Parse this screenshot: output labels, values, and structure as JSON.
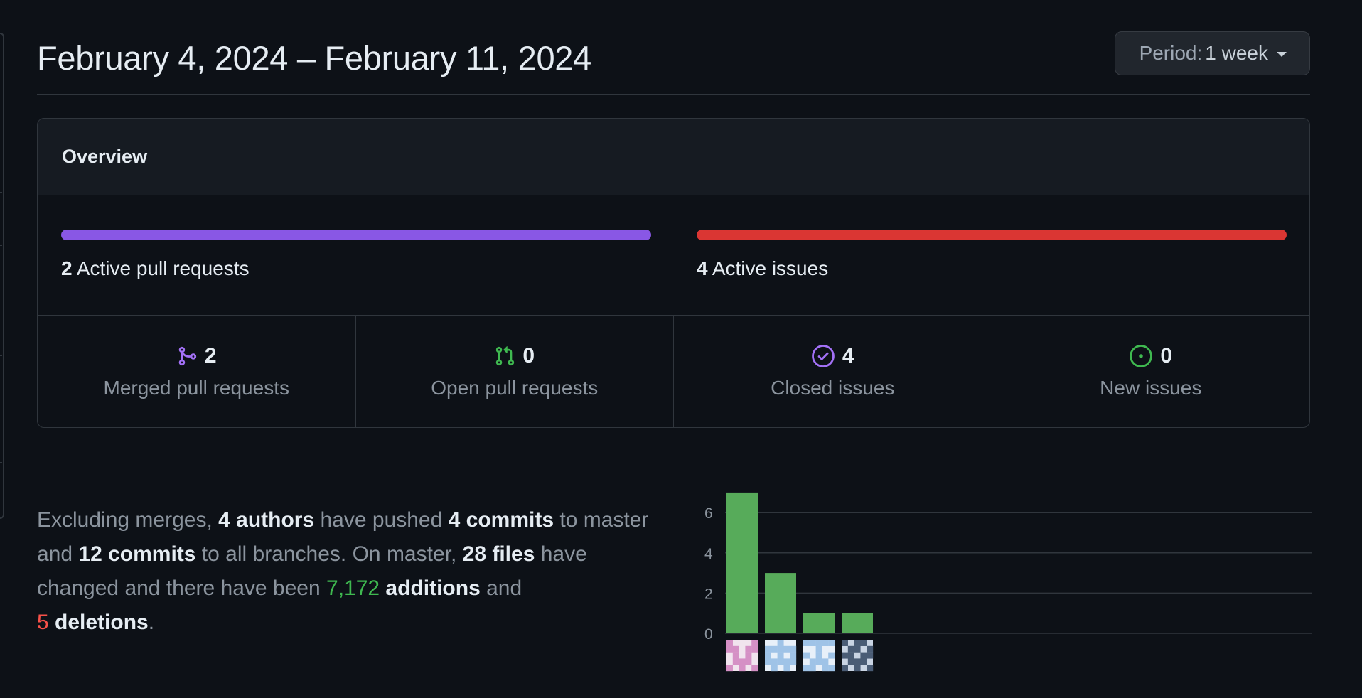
{
  "header": {
    "title": "February 4, 2024 – February 11, 2024",
    "period_prefix": "Period:",
    "period_value": "1 week"
  },
  "overview": {
    "heading": "Overview",
    "active_prs_count": "2",
    "active_prs_label": "Active pull requests",
    "active_issues_count": "4",
    "active_issues_label": "Active issues",
    "pr_bar_color": "#8957e5",
    "issue_bar_color": "#da3633",
    "stats": [
      {
        "icon": "git-merge-icon",
        "count": "2",
        "label": "Merged pull requests",
        "color": "#a371f7"
      },
      {
        "icon": "git-pull-request-icon",
        "count": "0",
        "label": "Open pull requests",
        "color": "#3fb950"
      },
      {
        "icon": "issue-closed-icon",
        "count": "4",
        "label": "Closed issues",
        "color": "#a371f7"
      },
      {
        "icon": "issue-opened-icon",
        "count": "0",
        "label": "New issues",
        "color": "#3fb950"
      }
    ]
  },
  "summary": {
    "t1": "Excluding merges, ",
    "authors": "4 authors",
    "t2": " have pushed ",
    "commits_master": "4 commits",
    "t3": " to master and ",
    "commits_all": "12 commits",
    "t4": " to all branches. On master, ",
    "files": "28 files",
    "t5": " have changed and there have been ",
    "additions_num": "7,172",
    "additions_word": " additions",
    "t6": " and ",
    "deletions_num": "5",
    "deletions_word": " deletions",
    "t7": "."
  },
  "chart_data": {
    "type": "bar",
    "categories": [
      "author-1",
      "author-2",
      "author-3",
      "author-4"
    ],
    "values": [
      7,
      3,
      1,
      1
    ],
    "yticks": [
      0,
      2,
      4,
      6
    ],
    "ylim": [
      0,
      7
    ],
    "grid": true,
    "bar_color": "#57ab5a"
  }
}
